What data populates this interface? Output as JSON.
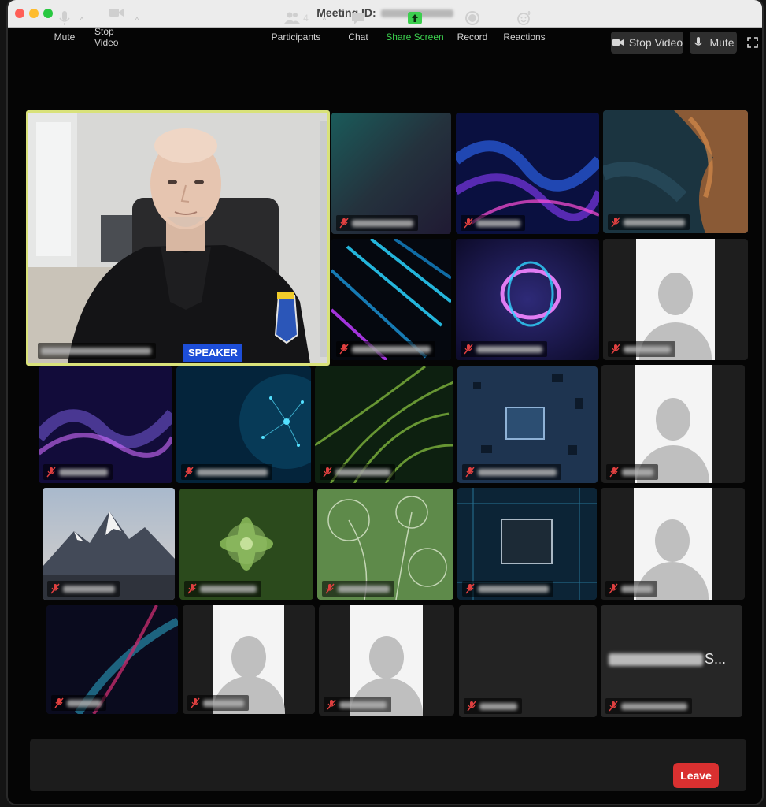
{
  "window": {
    "title": "Meeting ID:"
  },
  "top_controls": {
    "stop_video": "Stop Video",
    "mute": "Mute"
  },
  "speaker": {
    "tag": "SPEAKER"
  },
  "tiles": [
    {
      "id": "speaker",
      "type": "camera"
    },
    {
      "id": "t2",
      "type": "background",
      "bg": "teal-gradient"
    },
    {
      "id": "t3",
      "type": "background",
      "bg": "blue-wave"
    },
    {
      "id": "t4",
      "type": "background",
      "bg": "aerial-coast"
    },
    {
      "id": "t5",
      "type": "background",
      "bg": "neon-lines"
    },
    {
      "id": "t6",
      "type": "background",
      "bg": "purple-ring"
    },
    {
      "id": "t7",
      "type": "avatar"
    },
    {
      "id": "t8",
      "type": "background",
      "bg": "purple-dots"
    },
    {
      "id": "t9",
      "type": "background",
      "bg": "network"
    },
    {
      "id": "t10",
      "type": "background",
      "bg": "green-fern"
    },
    {
      "id": "t11",
      "type": "background",
      "bg": "circuit-chip"
    },
    {
      "id": "t12",
      "type": "avatar"
    },
    {
      "id": "t13",
      "type": "background",
      "bg": "mountains"
    },
    {
      "id": "t14",
      "type": "background",
      "bg": "succulent"
    },
    {
      "id": "t15",
      "type": "background",
      "bg": "dandelion"
    },
    {
      "id": "t16",
      "type": "background",
      "bg": "processor"
    },
    {
      "id": "t17",
      "type": "avatar"
    },
    {
      "id": "t18",
      "type": "background",
      "bg": "dark-streak"
    },
    {
      "id": "t19",
      "type": "avatar"
    },
    {
      "id": "t20",
      "type": "avatar"
    },
    {
      "id": "t21",
      "type": "empty"
    },
    {
      "id": "t22",
      "type": "name-only",
      "suffix": "S..."
    }
  ],
  "toolbar": {
    "mute": "Mute",
    "stop_video": "Stop Video",
    "participants": "Participants",
    "participants_count": "4",
    "chat": "Chat",
    "share_screen": "Share Screen",
    "record": "Record",
    "reactions": "Reactions",
    "leave": "Leave"
  },
  "colors": {
    "speaker_border": "#d9e27a",
    "speaker_tag": "#1d4ed8",
    "share_green": "#3ccf4e",
    "leave_red": "#d93030",
    "muted_red": "#e04040"
  }
}
